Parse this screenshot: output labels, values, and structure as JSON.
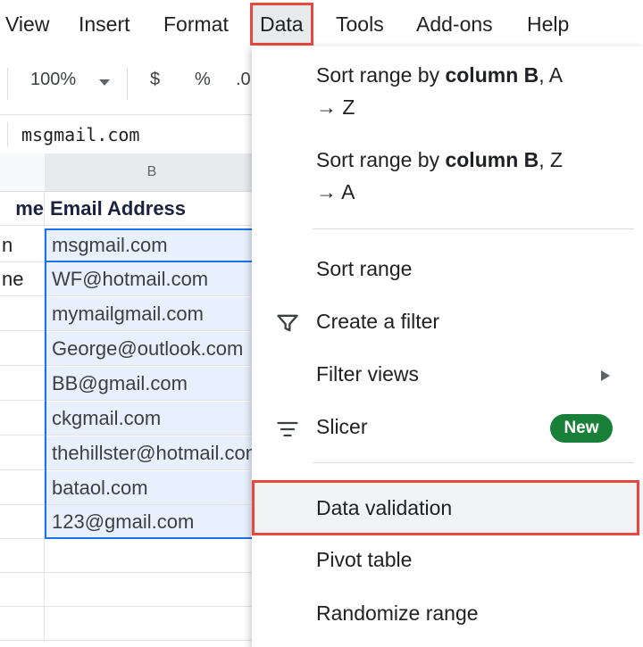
{
  "menubar": {
    "items": [
      "View",
      "Insert",
      "Format",
      "Data",
      "Tools",
      "Add-ons",
      "Help"
    ]
  },
  "toolbar": {
    "zoom": "100%",
    "zoom_arrow_icon": "caret-down-icon",
    "currency": "$",
    "percent": "%",
    "decimal": ".0"
  },
  "formula_bar": {
    "value": "msgmail.com"
  },
  "grid": {
    "col_b_header": "B",
    "header_row": {
      "a": "me",
      "b": "Email Address"
    },
    "rows": [
      {
        "a": "n",
        "b": "msgmail.com"
      },
      {
        "a": "ne",
        "b": "WF@hotmail.com"
      },
      {
        "a": "",
        "b": "mymailgmail.com"
      },
      {
        "a": "",
        "b": "George@outlook.com"
      },
      {
        "a": "",
        "b": "BB@gmail.com"
      },
      {
        "a": "",
        "b": "ckgmail.com"
      },
      {
        "a": "",
        "b": "thehillster@hotmail.com"
      },
      {
        "a": "",
        "b": "bataol.com"
      },
      {
        "a": "",
        "b": "123@gmail.com"
      }
    ]
  },
  "data_menu": {
    "sort_az": {
      "prefix": "Sort range by ",
      "bold": "column B",
      "suffix": ", A",
      "line2": "→ Z"
    },
    "sort_za": {
      "prefix": "Sort range by ",
      "bold": "column B",
      "suffix": ", Z",
      "line2": "→ A"
    },
    "sort_range": "Sort range",
    "create_filter": "Create a filter",
    "filter_views": "Filter views",
    "slicer": "Slicer",
    "new_badge": "New",
    "data_validation": "Data validation",
    "pivot_table": "Pivot table",
    "randomize_range": "Randomize range"
  },
  "colors": {
    "highlight": "#e8493f",
    "selection": "#1a73e8",
    "badge": "#188038"
  }
}
